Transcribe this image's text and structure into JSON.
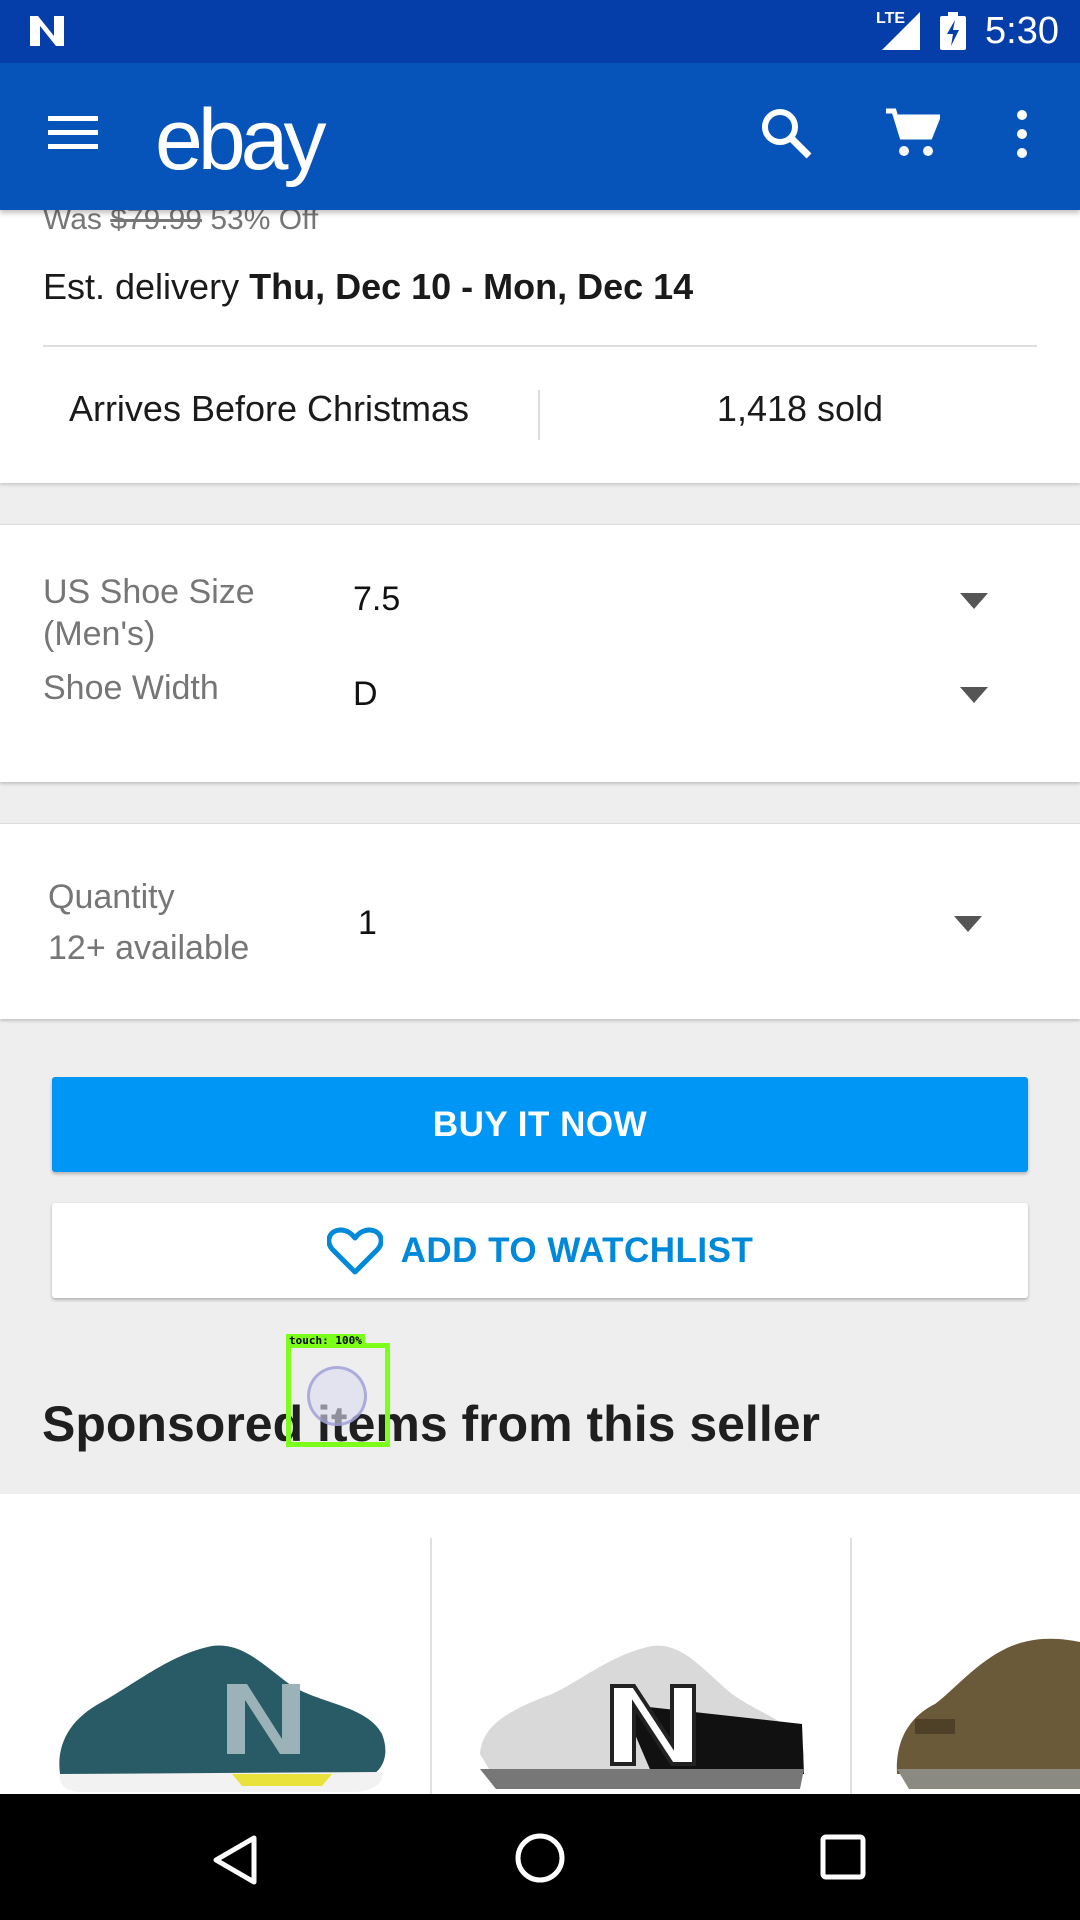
{
  "status_bar": {
    "network_label": "LTE",
    "time": "5:30"
  },
  "app_bar": {
    "logo_text": "ebay"
  },
  "pricing": {
    "was_label": "Was",
    "was_price": "$79.99",
    "discount": "53% Off"
  },
  "delivery": {
    "prefix": "Est. delivery",
    "dates": "Thu, Dec 10 - Mon, Dec 14"
  },
  "badges": {
    "left": "Arrives Before Christmas",
    "right": "1,418 sold"
  },
  "variations": [
    {
      "label": "US Shoe Size (Men's)",
      "value": "7.5"
    },
    {
      "label": "Shoe Width",
      "value": "D"
    }
  ],
  "quantity": {
    "label": "Quantity",
    "availability": "12+ available",
    "value": "1"
  },
  "actions": {
    "buy_label": "BUY IT NOW",
    "watch_label": "ADD TO WATCHLIST"
  },
  "sponsored": {
    "title": "Sponsored items from this seller"
  },
  "overlay": {
    "touch_label": "touch: 100%"
  },
  "colors": {
    "app_bar": "#0654ba",
    "status_bar": "#053ea8",
    "buy_button": "#0096f5",
    "watch_text": "#0089d8"
  }
}
